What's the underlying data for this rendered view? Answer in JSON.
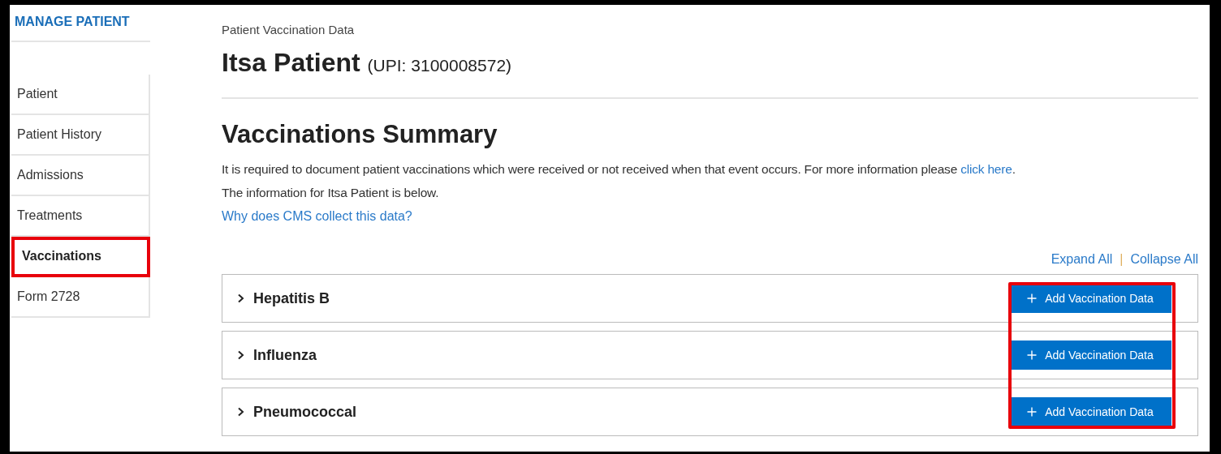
{
  "sidebar": {
    "title": "MANAGE PATIENT",
    "items": [
      {
        "label": "Patient",
        "selected": false,
        "highlighted": false
      },
      {
        "label": "Patient History",
        "selected": false,
        "highlighted": false
      },
      {
        "label": "Admissions",
        "selected": false,
        "highlighted": false
      },
      {
        "label": "Treatments",
        "selected": false,
        "highlighted": false
      },
      {
        "label": "Vaccinations",
        "selected": true,
        "highlighted": true
      },
      {
        "label": "Form 2728",
        "selected": false,
        "highlighted": false
      }
    ]
  },
  "breadcrumb": "Patient Vaccination Data",
  "patient": {
    "name": "Itsa Patient",
    "upi": "(UPI: 3100008572)"
  },
  "heading": "Vaccinations Summary",
  "intro": {
    "before": "It is required to document patient vaccinations which were received or not received when that event occurs. For more information please ",
    "link": "click here",
    "after": ".",
    "line2": "The information for Itsa Patient is below."
  },
  "why_link": "Why does CMS collect this data?",
  "expand_all": "Expand All",
  "separator": "|",
  "collapse_all": "Collapse All",
  "buttons_highlighted": true,
  "sections": [
    {
      "title": "Hepatitis B",
      "expanded": false,
      "button": "Add Vaccination Data"
    },
    {
      "title": "Influenza",
      "expanded": false,
      "button": "Add Vaccination Data"
    },
    {
      "title": "Pneumococcal",
      "expanded": false,
      "button": "Add Vaccination Data"
    }
  ]
}
